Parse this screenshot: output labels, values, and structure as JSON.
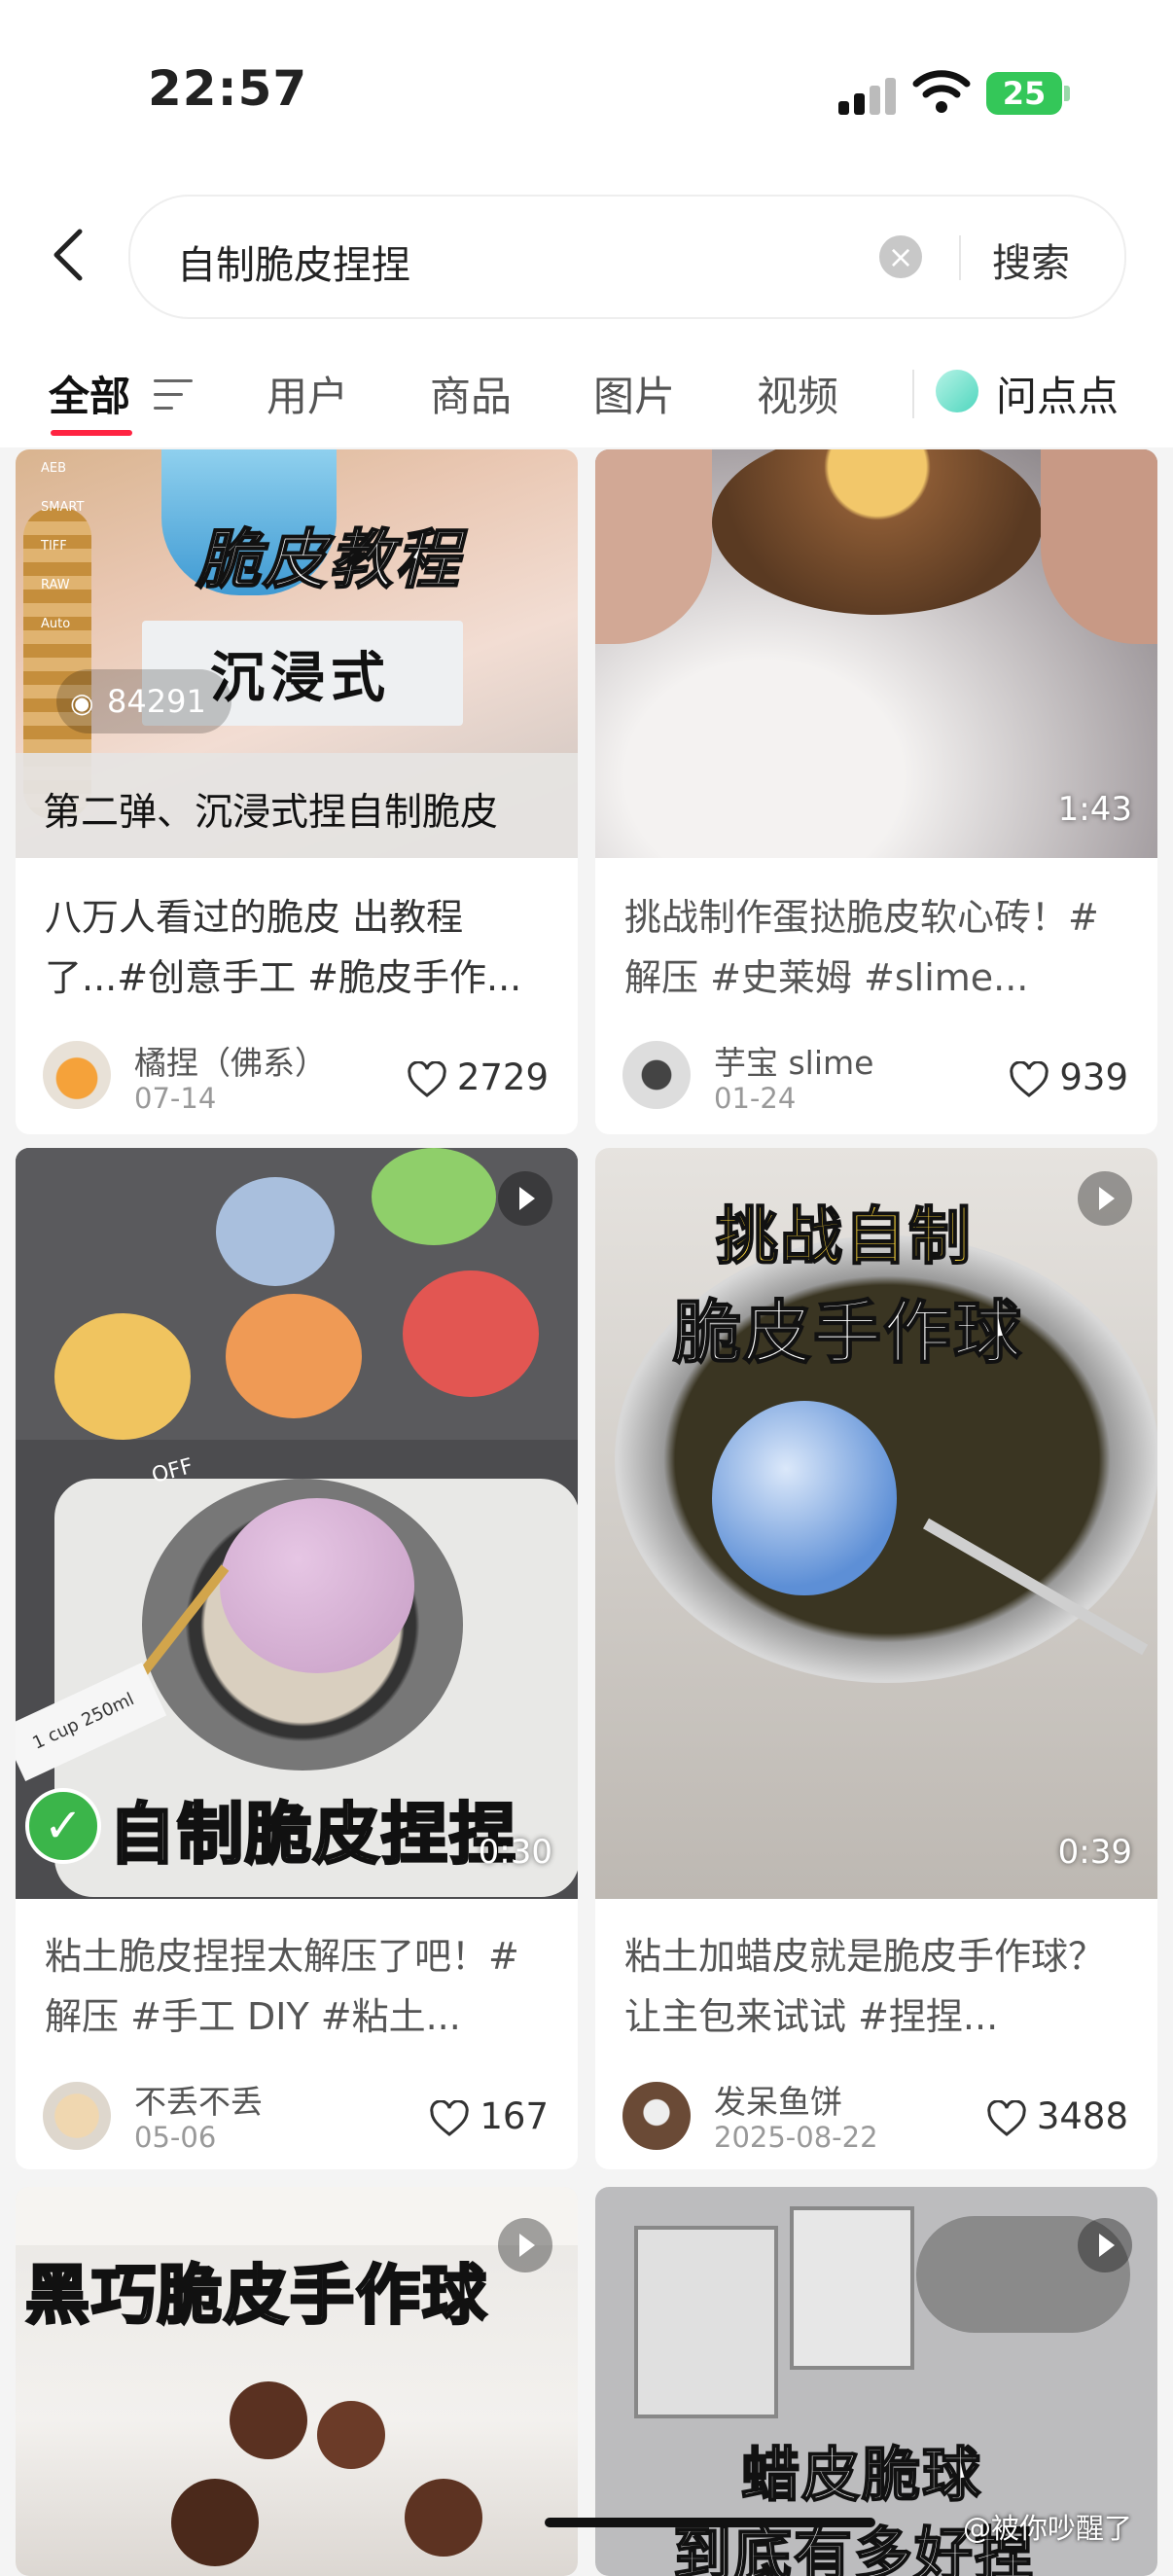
{
  "status_bar": {
    "time": "22:57",
    "battery": "25"
  },
  "search": {
    "query": "自制脆皮捏捏",
    "button": "搜索"
  },
  "tabs": {
    "all": "全部",
    "users": "用户",
    "goods": "商品",
    "images": "图片",
    "videos": "视频",
    "ask": "问点点"
  },
  "cards": [
    {
      "views": "84291",
      "thumb_caption": "第二弹、沉浸式捏自制脆皮",
      "thumb_title": "脆皮教程",
      "thumb_sub": "沉浸式",
      "cam_labels": [
        "AEB",
        "SMART",
        "TIFF",
        "RAW",
        "Auto"
      ],
      "title": "八万人看过的脆皮 出教程了...#创意手工 #脆皮手作...",
      "author": "橘捏（佛系）",
      "date": "07-14",
      "likes": "2729"
    },
    {
      "duration": "1:43",
      "title": "挑战制作蛋挞脆皮软心砖！#解压 #史莱姆 #slime...",
      "author": "芋宝 slime",
      "date": "01-24",
      "likes": "939"
    },
    {
      "duration": "0:30",
      "thumb_text": "自制脆皮捏捏",
      "cup_label": "1 cup 250ml",
      "off_label": "OFF",
      "title": "粘土脆皮捏捏太解压了吧！#解压 #手工 DIY #粘土...",
      "author": "不丢不丢",
      "date": "05-06",
      "likes": "167"
    },
    {
      "duration": "0:39",
      "thumb_line1": "挑战自制",
      "thumb_line2": "脆皮手作球",
      "title": "粘土加蜡皮就是脆皮手作球？让主包来试试 #捏捏...",
      "author": "发呆鱼饼",
      "date": "2025-08-22",
      "likes": "3488"
    },
    {
      "thumb_text": "黑巧脆皮手作球"
    },
    {
      "thumb_text": "蜡皮脆球",
      "thumb_text2": "到底有多好捏"
    }
  ],
  "watermark": "@被你吵醒了",
  "colors": {
    "accent": "#ff2442",
    "battery": "#34c759"
  }
}
